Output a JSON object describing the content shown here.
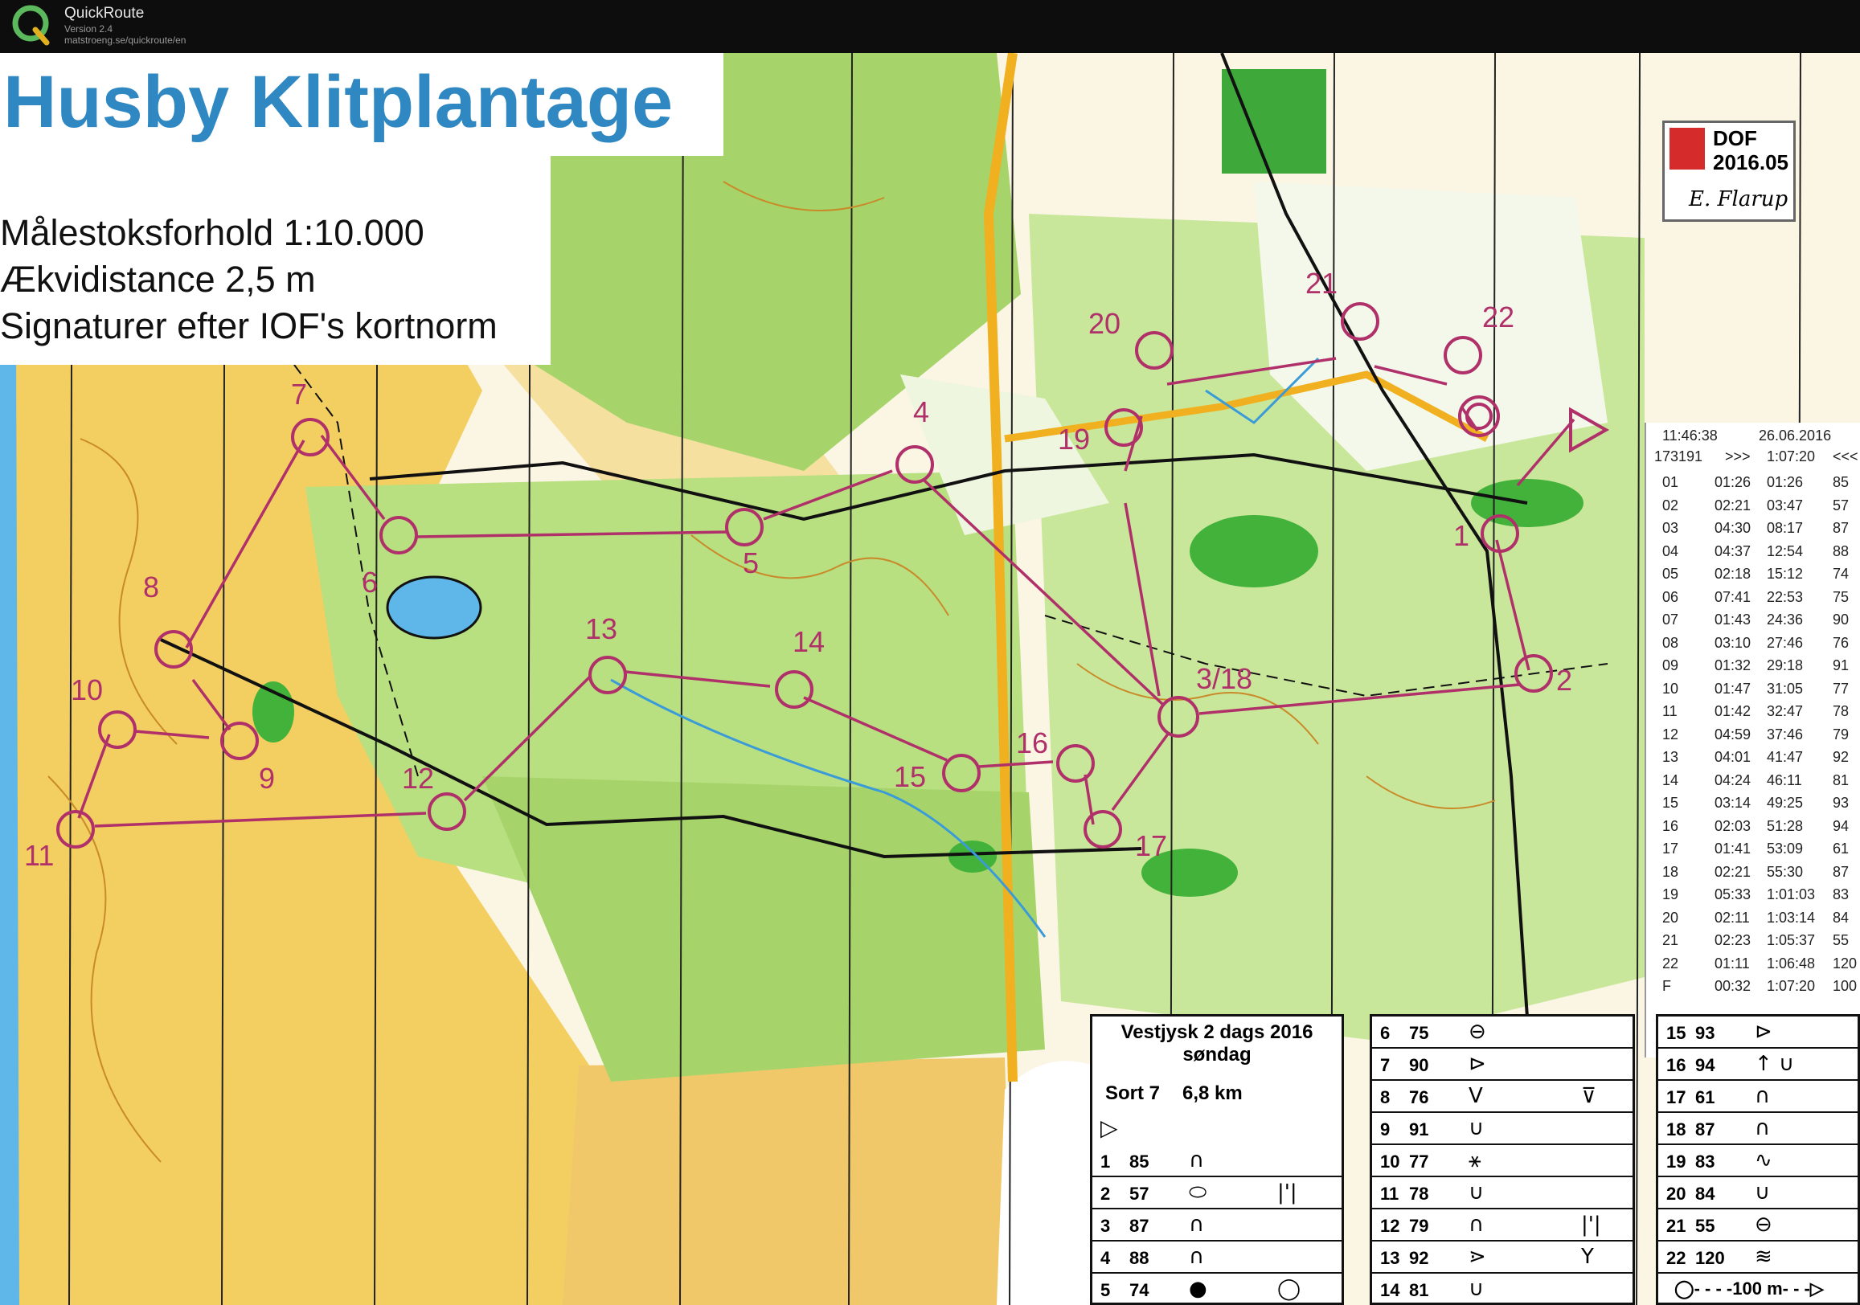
{
  "app": {
    "name": "QuickRoute",
    "version": "Version 2.4",
    "url": "matstroeng.se/quickroute/en",
    "logo_letter": "Q"
  },
  "map": {
    "title": "Husby Klitplantage",
    "scale_text": "Målestoksforhold 1:10.000",
    "contour_text": "Ækvidistance 2,5 m",
    "symbols_text": "Signaturer efter IOF's kortnorm"
  },
  "dof_badge": {
    "org": "DOF",
    "code": "2016.05",
    "signature": "E. Flarup"
  },
  "controls": [
    {
      "label": "1"
    },
    {
      "label": "2"
    },
    {
      "label": "3/18"
    },
    {
      "label": "4"
    },
    {
      "label": "5"
    },
    {
      "label": "6"
    },
    {
      "label": "7"
    },
    {
      "label": "8"
    },
    {
      "label": "9"
    },
    {
      "label": "10"
    },
    {
      "label": "11"
    },
    {
      "label": "12"
    },
    {
      "label": "13"
    },
    {
      "label": "14"
    },
    {
      "label": "15"
    },
    {
      "label": "16"
    },
    {
      "label": "17"
    },
    {
      "label": "19"
    },
    {
      "label": "20"
    },
    {
      "label": "21"
    },
    {
      "label": "22"
    }
  ],
  "splits": {
    "time": "11:46:38",
    "date": "26.06.2016",
    "runner_id": "173191",
    "arrows_in": ">>>",
    "total": "1:07:20",
    "arrows_out": "<<<",
    "rows": [
      {
        "leg": "01",
        "split": "01:26",
        "cum": "01:26",
        "code": "85"
      },
      {
        "leg": "02",
        "split": "02:21",
        "cum": "03:47",
        "code": "57"
      },
      {
        "leg": "03",
        "split": "04:30",
        "cum": "08:17",
        "code": "87"
      },
      {
        "leg": "04",
        "split": "04:37",
        "cum": "12:54",
        "code": "88"
      },
      {
        "leg": "05",
        "split": "02:18",
        "cum": "15:12",
        "code": "74"
      },
      {
        "leg": "06",
        "split": "07:41",
        "cum": "22:53",
        "code": "75"
      },
      {
        "leg": "07",
        "split": "01:43",
        "cum": "24:36",
        "code": "90"
      },
      {
        "leg": "08",
        "split": "03:10",
        "cum": "27:46",
        "code": "76"
      },
      {
        "leg": "09",
        "split": "01:32",
        "cum": "29:18",
        "code": "91"
      },
      {
        "leg": "10",
        "split": "01:47",
        "cum": "31:05",
        "code": "77"
      },
      {
        "leg": "11",
        "split": "01:42",
        "cum": "32:47",
        "code": "78"
      },
      {
        "leg": "12",
        "split": "04:59",
        "cum": "37:46",
        "code": "79"
      },
      {
        "leg": "13",
        "split": "04:01",
        "cum": "41:47",
        "code": "92"
      },
      {
        "leg": "14",
        "split": "04:24",
        "cum": "46:11",
        "code": "81"
      },
      {
        "leg": "15",
        "split": "03:14",
        "cum": "49:25",
        "code": "93"
      },
      {
        "leg": "16",
        "split": "02:03",
        "cum": "51:28",
        "code": "94"
      },
      {
        "leg": "17",
        "split": "01:41",
        "cum": "53:09",
        "code": "61"
      },
      {
        "leg": "18",
        "split": "02:21",
        "cum": "55:30",
        "code": "87"
      },
      {
        "leg": "19",
        "split": "05:33",
        "cum": "1:01:03",
        "code": "83"
      },
      {
        "leg": "20",
        "split": "02:11",
        "cum": "1:03:14",
        "code": "84"
      },
      {
        "leg": "21",
        "split": "02:23",
        "cum": "1:05:37",
        "code": "55"
      },
      {
        "leg": "22",
        "split": "01:11",
        "cum": "1:06:48",
        "code": "120"
      },
      {
        "leg": "F",
        "split": "00:32",
        "cum": "1:07:20",
        "code": "100"
      }
    ]
  },
  "course": {
    "event": "Vestjysk 2 dags 2016",
    "day": "søndag",
    "class": "Sort 7",
    "length": "6,8 km",
    "start_symbol": "▷",
    "descriptions_a": [
      {
        "num": "1",
        "code": "85",
        "sym": "∩",
        "extra": ""
      },
      {
        "num": "2",
        "code": "57",
        "sym": "⬭",
        "extra": "|'|"
      },
      {
        "num": "3",
        "code": "87",
        "sym": "∩",
        "extra": ""
      },
      {
        "num": "4",
        "code": "88",
        "sym": "∩",
        "extra": ""
      },
      {
        "num": "5",
        "code": "74",
        "sym": "●",
        "extra": "◯"
      }
    ],
    "descriptions_b": [
      {
        "num": "6",
        "code": "75",
        "sym": "⊖",
        "extra": ""
      },
      {
        "num": "7",
        "code": "90",
        "sym": "⊳",
        "extra": ""
      },
      {
        "num": "8",
        "code": "76",
        "sym": "V",
        "extra": "⊽"
      },
      {
        "num": "9",
        "code": "91",
        "sym": "∪",
        "extra": ""
      },
      {
        "num": "10",
        "code": "77",
        "sym": "⚹",
        "extra": ""
      },
      {
        "num": "11",
        "code": "78",
        "sym": "∪",
        "extra": ""
      },
      {
        "num": "12",
        "code": "79",
        "sym": "∩",
        "extra": "|'|"
      },
      {
        "num": "13",
        "code": "92",
        "sym": "⋗",
        "extra": "Y"
      },
      {
        "num": "14",
        "code": "81",
        "sym": "∪",
        "extra": ""
      }
    ],
    "descriptions_c": [
      {
        "num": "15",
        "code": "93",
        "sym": "⊳",
        "extra": ""
      },
      {
        "num": "16",
        "code": "94",
        "sym": "↑ ∪",
        "extra": ""
      },
      {
        "num": "17",
        "code": "61",
        "sym": "∩",
        "extra": ""
      },
      {
        "num": "18",
        "code": "87",
        "sym": "∩",
        "extra": ""
      },
      {
        "num": "19",
        "code": "83",
        "sym": "∿",
        "extra": ""
      },
      {
        "num": "20",
        "code": "84",
        "sym": "∪",
        "extra": ""
      },
      {
        "num": "21",
        "code": "55",
        "sym": "⊖",
        "extra": ""
      },
      {
        "num": "22",
        "code": "120",
        "sym": "≋",
        "extra": ""
      }
    ],
    "finish_note": "100 m"
  },
  "colors": {
    "purple": "#b0306a",
    "forest": "#a6d46a",
    "dark_green": "#42b23a",
    "open_yellow": "#f3cf62",
    "water_blue": "#5fb6e8",
    "title_blue": "#2f88c1"
  }
}
